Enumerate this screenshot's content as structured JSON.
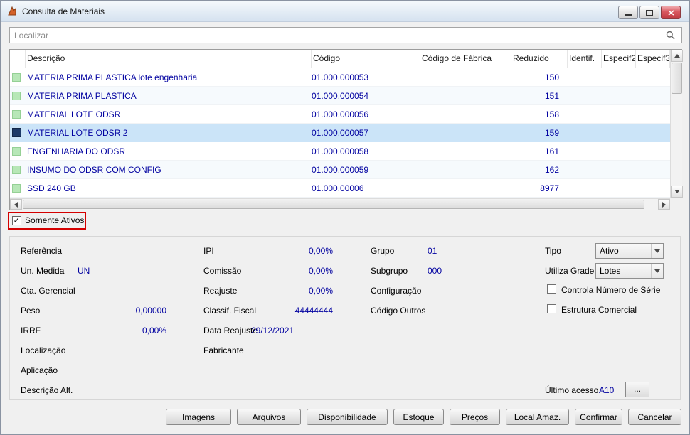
{
  "window": {
    "title": "Consulta de Materiais"
  },
  "search": {
    "placeholder": "Localizar"
  },
  "table": {
    "columns": [
      "Descrição",
      "Código",
      "Código de Fábrica",
      "Reduzido",
      "Identif.",
      "Especif2",
      "Especif3"
    ],
    "rows": [
      {
        "descricao": "MATERIA PRIMA PLASTICA lote engenharia",
        "codigo": "01.000.000053",
        "codigo_fabrica": "",
        "reduzido": "150"
      },
      {
        "descricao": "MATERIA PRIMA PLASTICA",
        "codigo": "01.000.000054",
        "codigo_fabrica": "",
        "reduzido": "151"
      },
      {
        "descricao": "MATERIAL LOTE ODSR",
        "codigo": "01.000.000056",
        "codigo_fabrica": "",
        "reduzido": "158"
      },
      {
        "descricao": "MATERIAL LOTE ODSR 2",
        "codigo": "01.000.000057",
        "codigo_fabrica": "",
        "reduzido": "159"
      },
      {
        "descricao": "ENGENHARIA DO ODSR",
        "codigo": "01.000.000058",
        "codigo_fabrica": "",
        "reduzido": "161"
      },
      {
        "descricao": "INSUMO DO ODSR COM CONFIG",
        "codigo": "01.000.000059",
        "codigo_fabrica": "",
        "reduzido": "162"
      },
      {
        "descricao": "SSD 240 GB",
        "codigo": "01.000.00006",
        "codigo_fabrica": "",
        "reduzido": "8977"
      }
    ],
    "selected_row_index": 3
  },
  "filters": {
    "somente_ativos_label": "Somente Ativos",
    "checked": true,
    "checkmark": "✓"
  },
  "details": {
    "referencia": {
      "label": "Referência",
      "value": ""
    },
    "un_medida": {
      "label": "Un. Medida",
      "value": "UN"
    },
    "cta_gerencial": {
      "label": "Cta. Gerencial",
      "value": ""
    },
    "peso": {
      "label": "Peso",
      "value": "0,00000"
    },
    "irrf": {
      "label": "IRRF",
      "value": "0,00%"
    },
    "localizacao": {
      "label": "Localização",
      "value": ""
    },
    "aplicacao": {
      "label": "Aplicação",
      "value": ""
    },
    "descricao_alt": {
      "label": "Descrição Alt.",
      "value": ""
    },
    "ipi": {
      "label": "IPI",
      "value": "0,00%"
    },
    "comissao": {
      "label": "Comissão",
      "value": "0,00%"
    },
    "reajuste": {
      "label": "Reajuste",
      "value": "0,00%"
    },
    "classif_fiscal": {
      "label": "Classif. Fiscal",
      "value": "44444444"
    },
    "data_reajuste": {
      "label": "Data Reajuste",
      "value": "29/12/2021"
    },
    "fabricante": {
      "label": "Fabricante",
      "value": ""
    },
    "grupo": {
      "label": "Grupo",
      "value": "01"
    },
    "subgrupo": {
      "label": "Subgrupo",
      "value": "000"
    },
    "configuracao": {
      "label": "Configuração",
      "value": ""
    },
    "codigo_outros": {
      "label": "Código Outros",
      "value": ""
    },
    "tipo": {
      "label": "Tipo",
      "value": "Ativo"
    },
    "utiliza_grade": {
      "label": "Utiliza Grade",
      "value": "Lotes"
    },
    "controla_serie": {
      "label": "Controla Número de Série",
      "checked": false
    },
    "estrutura_comercial": {
      "label": "Estrutura Comercial",
      "checked": false
    },
    "ultimo_acesso": {
      "label": "Último acesso",
      "value": "A10",
      "button": "..."
    }
  },
  "footer": {
    "buttons": [
      "Imagens",
      "Arquivos",
      "Disponibilidade",
      "Estoque",
      "Preços",
      "Local Amaz.",
      "Confirmar",
      "Cancelar"
    ]
  }
}
